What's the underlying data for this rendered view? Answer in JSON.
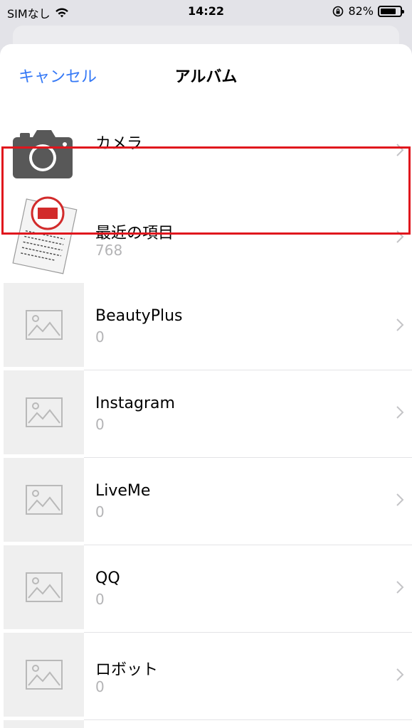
{
  "status": {
    "carrier": "SIMなし",
    "time": "14:22",
    "battery_percent": "82%",
    "battery_level": 0.82
  },
  "nav": {
    "cancel_label": "キャンセル",
    "title": "アルバム"
  },
  "albums": [
    {
      "name": "カメラ",
      "count": ""
    },
    {
      "name": "最近の項目",
      "count": "768"
    },
    {
      "name": "BeautyPlus",
      "count": "0"
    },
    {
      "name": "Instagram",
      "count": "0"
    },
    {
      "name": "LiveMe",
      "count": "0"
    },
    {
      "name": "QQ",
      "count": "0"
    },
    {
      "name": "ロボット",
      "count": "0"
    }
  ],
  "colors": {
    "accent": "#3478f6",
    "highlight": "#e0161d",
    "secondary_text": "#b4b4b6"
  }
}
